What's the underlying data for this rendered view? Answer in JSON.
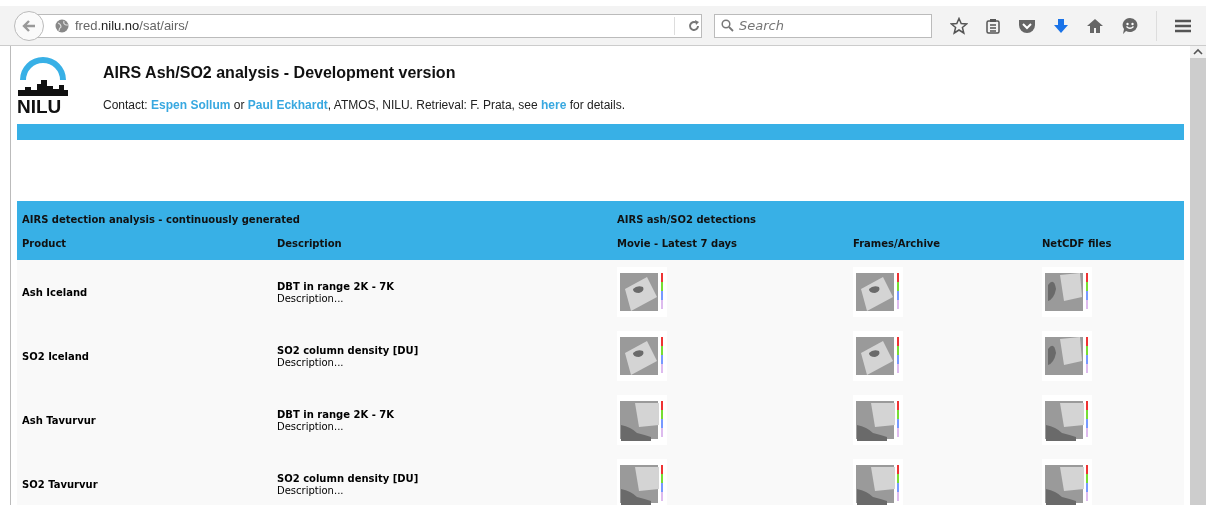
{
  "browser": {
    "url": "fred.**nilu.no**/sat/airs/",
    "search": {
      "placeholder": "Search"
    }
  },
  "header": {
    "logo_text": "NILU",
    "title": "AIRS Ash/SO2 analysis - Development version",
    "contact": [
      {
        "text": "Contact: ",
        "link": false
      },
      {
        "text": "Espen Sollum",
        "link": true
      },
      {
        "text": " or ",
        "link": false
      },
      {
        "text": "Paul Eckhardt",
        "link": true
      },
      {
        "text": ", ATMOS, NILU. Retrieval: F. Prata, see ",
        "link": false
      },
      {
        "text": "here",
        "link": true
      },
      {
        "text": " for details.",
        "link": false
      }
    ]
  },
  "table": {
    "group_left": "AIRS detection analysis - continuously generated",
    "group_right": "AIRS ash/SO2 detections",
    "columns": [
      "Product",
      "Description",
      "Movie - Latest 7 days",
      "Frames/Archive",
      "NetCDF files"
    ],
    "rows": [
      {
        "product": "Ash Iceland",
        "description": "DBT in range 2K - 7K",
        "note": "Description..."
      },
      {
        "product": "SO2 Iceland",
        "description": "SO2 column density [DU]",
        "note": "Description..."
      },
      {
        "product": "Ash Tavurvur",
        "description": "DBT in range 2K - 7K",
        "note": "Description..."
      },
      {
        "product": "SO2 Tavurvur",
        "description": "SO2 column density [DU]",
        "note": "Description..."
      }
    ]
  }
}
